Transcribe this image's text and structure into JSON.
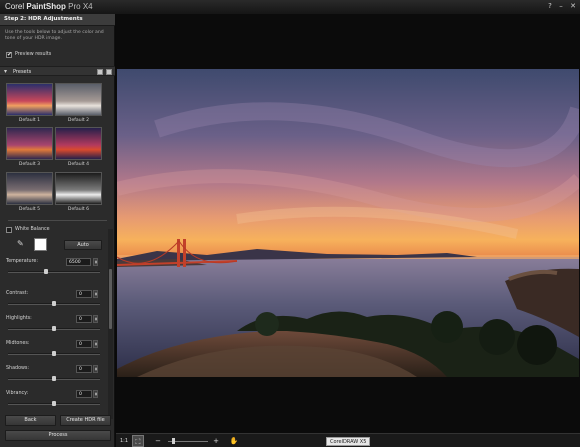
{
  "app": {
    "brand_corel": "Corel",
    "brand_name": "PaintShop",
    "brand_suffix": "Pro X4",
    "help_glyph": "?",
    "minimize_glyph": "–",
    "close_glyph": "✕"
  },
  "panel": {
    "step_title": "Step 2: HDR Adjustments",
    "intro": "Use the tools below to adjust the color and tone of your HDR image.",
    "preview_label": "Preview results",
    "preview_checked": true,
    "presets_title": "Presets",
    "presets": [
      {
        "label": "Default 1",
        "colors": [
          "#2b2f6b",
          "#c8475b",
          "#f0a060"
        ]
      },
      {
        "label": "Default 2",
        "colors": [
          "#5a5f6a",
          "#a59a95",
          "#e8e2dc"
        ]
      },
      {
        "label": "Default 3",
        "colors": [
          "#30284f",
          "#a8456e",
          "#e07a3a"
        ]
      },
      {
        "label": "Default 4",
        "colors": [
          "#26204a",
          "#b23a5e",
          "#d94a2e"
        ]
      },
      {
        "label": "Default 5",
        "colors": [
          "#2c3040",
          "#7a6e72",
          "#cfb49e"
        ]
      },
      {
        "label": "Default 6",
        "colors": [
          "#1c1c1c",
          "#7c7c7c",
          "#ececec"
        ]
      }
    ],
    "white_balance_label": "White Balance",
    "auto_label": "Auto",
    "temperature_label": "Temperature:",
    "temperature_value": "6500",
    "sliders": [
      {
        "key": "contrast",
        "label": "Contrast:",
        "value": "0"
      },
      {
        "key": "highlights",
        "label": "Highlights:",
        "value": "0"
      },
      {
        "key": "midtones",
        "label": "Midtones:",
        "value": "0"
      },
      {
        "key": "shadows",
        "label": "Shadows:",
        "value": "0"
      },
      {
        "key": "vibrancy",
        "label": "Vibrancy:",
        "value": "0"
      }
    ],
    "back_label": "Back",
    "create_label": "Create HDR file",
    "process_label": "Process"
  },
  "toolbar": {
    "actual_size_glyph": "1:1",
    "fit_glyph": "⛶",
    "zoom_out_glyph": "−",
    "zoom_in_glyph": "+",
    "pan_glyph": "✋",
    "tooltip": "CorelDRAW X5"
  }
}
